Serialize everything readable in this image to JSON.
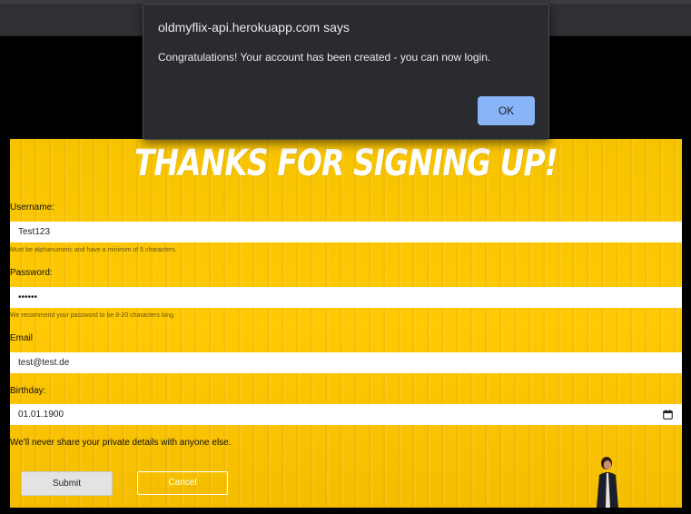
{
  "dialog": {
    "title": "oldmyflix-api.herokuapp.com says",
    "message": "Congratulations! Your account has been created - you can now login.",
    "ok_label": "OK"
  },
  "page": {
    "title": "Thanks for signing up!",
    "privacy_note": "We'll never share your private details with anyone else."
  },
  "form": {
    "username": {
      "label": "Username:",
      "value": "Test123",
      "hint": "Must be alphanumeric and have a minimim of 5 characters."
    },
    "password": {
      "label": "Password:",
      "value": "••••••",
      "hint": "We recommend your password to be 8-20 characters long."
    },
    "email": {
      "label": "Email",
      "value": "test@test.de"
    },
    "birthday": {
      "label": "Birthday:",
      "value": "01.01.1900"
    },
    "submit_label": "Submit",
    "cancel_label": "Cancel"
  },
  "colors": {
    "background": "#ffc904",
    "dialog_bg": "#2a2b2f",
    "ok_button": "#8ab4f8"
  },
  "icons": [
    "calendar-icon"
  ]
}
